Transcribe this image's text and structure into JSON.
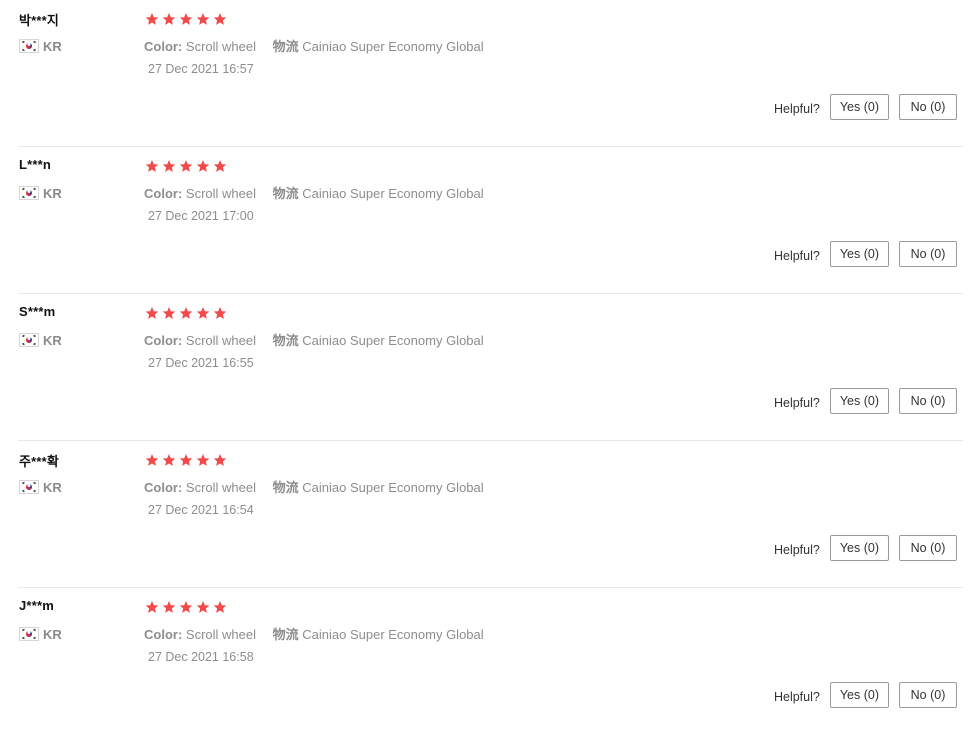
{
  "colors": {
    "star": "#f14a4a",
    "muted_text": "#8d8d8d",
    "divider": "#e8e8e8"
  },
  "icons": {
    "rating": "star-icon",
    "country_flag": "south-korea-flag-icon"
  },
  "reviews": [
    {
      "user": "박***지",
      "country": "KR",
      "rating": 5,
      "color_key": "Color:",
      "color_value": "Scroll wheel",
      "shipping_key": "物流",
      "shipping_value": "Cainiao Super Economy Global",
      "date": "27 Dec 2021 16:57",
      "helpful_label": "Helpful?",
      "yes_label": "Yes (0)",
      "no_label": "No (0)"
    },
    {
      "user": "L***n",
      "country": "KR",
      "rating": 5,
      "color_key": "Color:",
      "color_value": "Scroll wheel",
      "shipping_key": "物流",
      "shipping_value": "Cainiao Super Economy Global",
      "date": "27 Dec 2021 17:00",
      "helpful_label": "Helpful?",
      "yes_label": "Yes (0)",
      "no_label": "No (0)"
    },
    {
      "user": "S***m",
      "country": "KR",
      "rating": 5,
      "color_key": "Color:",
      "color_value": "Scroll wheel",
      "shipping_key": "物流",
      "shipping_value": "Cainiao Super Economy Global",
      "date": "27 Dec 2021 16:55",
      "helpful_label": "Helpful?",
      "yes_label": "Yes (0)",
      "no_label": "No (0)"
    },
    {
      "user": "주***확",
      "country": "KR",
      "rating": 5,
      "color_key": "Color:",
      "color_value": "Scroll wheel",
      "shipping_key": "物流",
      "shipping_value": "Cainiao Super Economy Global",
      "date": "27 Dec 2021 16:54",
      "helpful_label": "Helpful?",
      "yes_label": "Yes (0)",
      "no_label": "No (0)"
    },
    {
      "user": "J***m",
      "country": "KR",
      "rating": 5,
      "color_key": "Color:",
      "color_value": "Scroll wheel",
      "shipping_key": "物流",
      "shipping_value": "Cainiao Super Economy Global",
      "date": "27 Dec 2021 16:58",
      "helpful_label": "Helpful?",
      "yes_label": "Yes (0)",
      "no_label": "No (0)"
    }
  ]
}
